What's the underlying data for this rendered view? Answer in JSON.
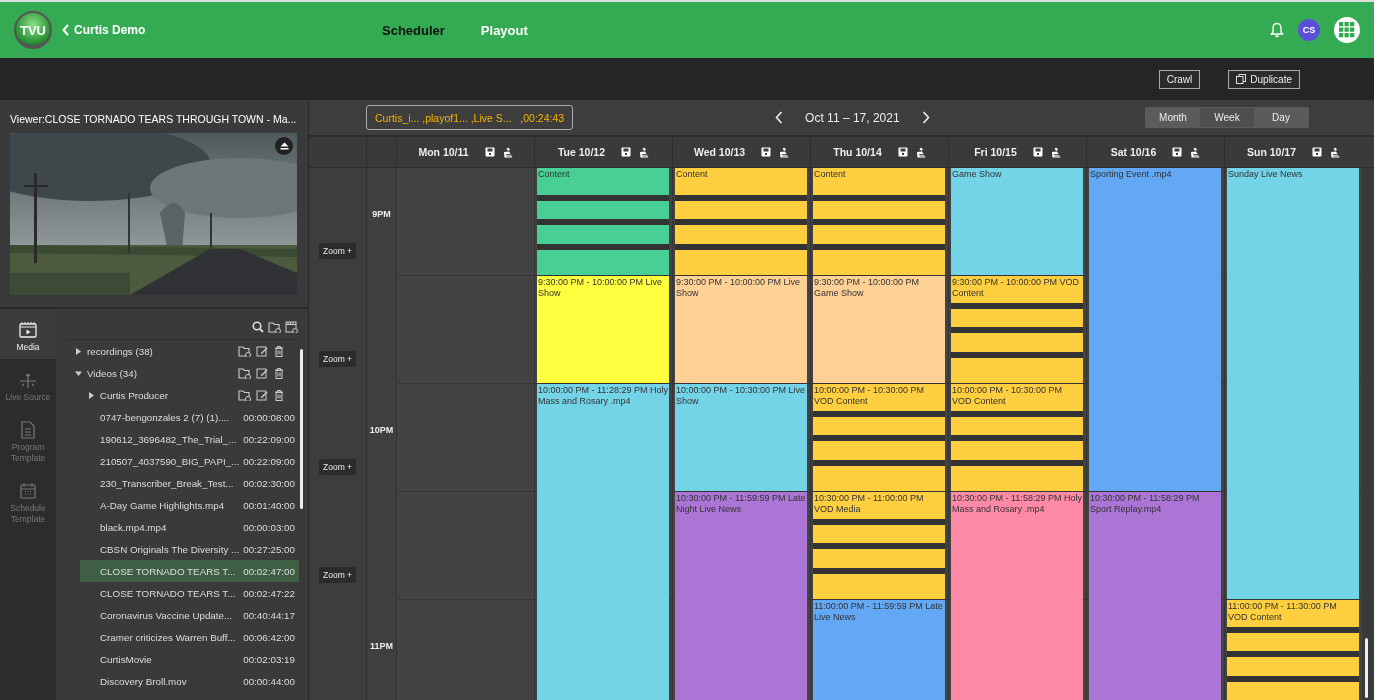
{
  "header": {
    "logo": "TVU",
    "back_label": "Curtis Demo",
    "avatar": "CS",
    "nav": [
      {
        "label": "Scheduler",
        "selected": true
      },
      {
        "label": "Playout",
        "selected": false
      }
    ]
  },
  "toolbar": {
    "buttons": [
      {
        "label": "Crawl",
        "kind": "plain"
      },
      {
        "label": "Duplicate",
        "kind": "copy"
      }
    ]
  },
  "viewer": {
    "title": "Viewer:CLOSE TORNADO TEARS THROUGH TOWN - Ma..."
  },
  "sidebar": {
    "items": [
      {
        "label": "Media",
        "kind": "media",
        "selected": true
      },
      {
        "label": "Live Source",
        "kind": "live",
        "selected": false
      },
      {
        "label": "Program Template",
        "kind": "program",
        "selected": false
      },
      {
        "label": "Schedule Template",
        "kind": "schedule",
        "selected": false
      }
    ]
  },
  "library": {
    "items": [
      {
        "kind": "folder",
        "name": "recordings (38)",
        "expanded": false,
        "selected": false
      },
      {
        "kind": "folder",
        "name": "Videos (34)",
        "expanded": true,
        "selected": false,
        "children": [
          {
            "kind": "folder",
            "name": "Curtis Producer",
            "expanded": false,
            "selected": false
          },
          {
            "kind": "file",
            "name": "0747-bengonzales 2 (7) (1)....",
            "duration": "00:00:08:00",
            "selected": false
          },
          {
            "kind": "file",
            "name": "190612_3696482_The_Trial_...",
            "duration": "00:22:09:00",
            "selected": false
          },
          {
            "kind": "file",
            "name": "210507_4037590_BIG_PAPI_...",
            "duration": "00:22:09:00",
            "selected": false
          },
          {
            "kind": "file",
            "name": "230_Transcriber_Break_Test...",
            "duration": "00:02:30:00",
            "selected": false
          },
          {
            "kind": "file",
            "name": "A-Day Game Highlights.mp4",
            "duration": "00:01:40:00",
            "selected": false
          },
          {
            "kind": "file",
            "name": "black.mp4.mp4",
            "duration": "00:00:03:00",
            "selected": false
          },
          {
            "kind": "file",
            "name": "CBSN Originals The Diversity ...",
            "duration": "00:27:25:00",
            "selected": false
          },
          {
            "kind": "file",
            "name": "CLOSE TORNADO TEARS T...",
            "duration": "00:02:47:00",
            "selected": true
          },
          {
            "kind": "file",
            "name": "CLOSE TORNADO TEARS T...",
            "duration": "00:02:47:22",
            "selected": false
          },
          {
            "kind": "file",
            "name": "Coronavirus Vaccine Update...",
            "duration": "00:40:44:17",
            "selected": false
          },
          {
            "kind": "file",
            "name": "Cramer criticizes Warren Buff...",
            "duration": "00:06:42:00",
            "selected": false
          },
          {
            "kind": "file",
            "name": "CurtisMovie",
            "duration": "00:02:03:19",
            "selected": false
          },
          {
            "kind": "file",
            "name": "Discovery Broll.mov",
            "duration": "00:00:44:00",
            "selected": false
          }
        ]
      }
    ]
  },
  "calendar": {
    "playlist": "Curtis_i... ,playof1... ,Live S...   ,00:24:43",
    "range": "Oct 11 – 17, 2021",
    "views": [
      {
        "label": "Month",
        "selected": false
      },
      {
        "label": "Week",
        "selected": true
      },
      {
        "label": "Day",
        "selected": false
      }
    ],
    "zoom_buttons": [
      "Zoom +",
      "Zoom +",
      "Zoom +",
      "Zoom +"
    ],
    "time_labels": [
      "9PM",
      "10PM",
      "11PM"
    ],
    "days": [
      {
        "label": "Mon 10/11"
      },
      {
        "label": "Tue 10/12",
        "events": [
          {
            "kind": "segmented-half",
            "color": "#48cf93",
            "text": "Content"
          },
          {
            "kind": "plain-half",
            "color": "#ffff40",
            "text": "9:30:00 PM - 10:00:00 PM Live Show"
          },
          {
            "kind": "plain-ninety",
            "color": "#74d4e7",
            "text": "10:00:00 PM - 11:28:29 PM Holy Mass and Rosary .mp4"
          }
        ]
      },
      {
        "label": "Wed 10/13",
        "events": [
          {
            "kind": "segmented-half",
            "color": "#ffcf40",
            "text": "Content"
          },
          {
            "kind": "plain-half",
            "color": "#ffd196",
            "text": "9:30:00 PM - 10:00:00 PM Live Show"
          },
          {
            "kind": "plain-half",
            "color": "#74d4e7",
            "text": "10:00:00 PM - 10:30:00 PM Live Show"
          },
          {
            "kind": "plain-ninety",
            "color": "#aa75d4",
            "text": "10:30:00 PM - 11:59:59 PM Late Night Live News"
          }
        ]
      },
      {
        "label": "Thu 10/14",
        "events": [
          {
            "kind": "segmented-half",
            "color": "#ffcf40",
            "text": "Content"
          },
          {
            "kind": "plain-half",
            "color": "#ffd196",
            "text": "9:30:00 PM - 10:00:00 PM Game Show"
          },
          {
            "kind": "segmented-half",
            "color": "#ffcf40",
            "text": "10:00:00 PM - 10:30:00 PM VOD Content"
          },
          {
            "kind": "segmented-half",
            "color": "#ffcf40",
            "text": "10:30:00 PM - 11:00:00 PM VOD Media"
          },
          {
            "kind": "plain-hour",
            "color": "#62a8f5",
            "text": "11:00:00 PM - 11:59:59 PM Late Live News"
          }
        ]
      },
      {
        "label": "Fri 10/15",
        "events": [
          {
            "kind": "plain-half",
            "color": "#74d4e7",
            "text": "Game Show"
          },
          {
            "kind": "segmented-half",
            "color": "#ffcf40",
            "text": "9:30:00 PM - 10:00:00 PM VOD Content"
          },
          {
            "kind": "segmented-half",
            "color": "#ffcf40",
            "text": "10:00:00 PM - 10:30:00 PM VOD Content"
          },
          {
            "kind": "plain-ninety",
            "color": "#ff8aa8",
            "text": "10:30:00 PM - 11:58:29 PM Holy Mass and Rosary .mp4"
          }
        ]
      },
      {
        "label": "Sat 10/16",
        "events": [
          {
            "kind": "plain-ninety",
            "color": "#62a8f5",
            "text": "Sporting Event .mp4"
          },
          {
            "kind": "plain-ninety",
            "color": "#aa75d4",
            "text": "10:30:00 PM - 11:58:29 PM Sport Replay.mp4"
          }
        ]
      },
      {
        "label": "Sun 10/17",
        "events": [
          {
            "kind": "plain-two-hours",
            "color": "#74d4e7",
            "text": "Sunday Live News"
          },
          {
            "kind": "segmented-half",
            "color": "#ffcf40",
            "text": "11:00:00 PM - 11:30:00 PM VOD Content"
          }
        ]
      }
    ]
  }
}
